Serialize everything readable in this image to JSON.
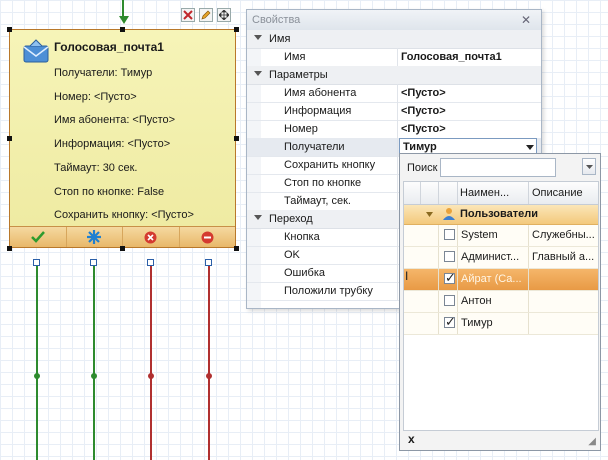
{
  "node": {
    "title": "Голосовая_почта1",
    "lines": [
      "Получатели: Тимур",
      "Номер: <Пусто>",
      "Имя абонента: <Пусто>",
      "Информация: <Пусто>",
      "Таймаут: 30 сек.",
      "Стоп по кнопке: False",
      "Сохранить кнопку: <Пусто>"
    ]
  },
  "properties": {
    "title": "Свойства",
    "close": "✕",
    "categories": {
      "name": "Имя",
      "params": "Параметры",
      "transition": "Переход"
    },
    "rows": {
      "name": {
        "label": "Имя",
        "value": "Голосовая_почта1"
      },
      "subscriber": {
        "label": "Имя абонента",
        "value": "<Пусто>"
      },
      "info": {
        "label": "Информация",
        "value": "<Пусто>"
      },
      "number": {
        "label": "Номер",
        "value": "<Пусто>"
      },
      "recipients": {
        "label": "Получатели",
        "value": "Тимур"
      },
      "save_button": {
        "label": "Сохранить кнопку",
        "value": ""
      },
      "stop_button": {
        "label": "Стоп по кнопке",
        "value": ""
      },
      "timeout": {
        "label": "Таймаут, сек.",
        "value": ""
      },
      "button": {
        "label": "Кнопка",
        "value": ""
      },
      "ok": {
        "label": "OK",
        "value": ""
      },
      "error": {
        "label": "Ошибка",
        "value": ""
      },
      "hangup": {
        "label": "Положили трубку",
        "value": ""
      }
    }
  },
  "popup": {
    "search_label": "Поиск",
    "search_value": "",
    "columns": [
      "Наимен...",
      "Описание"
    ],
    "group": "Пользователи",
    "rows": [
      {
        "name": "System",
        "desc": "Служебны...",
        "checked": false
      },
      {
        "name": "Админист...",
        "desc": "Главный а...",
        "checked": false
      },
      {
        "name": "Айрат (Са...",
        "desc": "",
        "checked": true
      },
      {
        "name": "Антон",
        "desc": "",
        "checked": false
      },
      {
        "name": "Тимур",
        "desc": "",
        "checked": true
      }
    ],
    "clear": "x"
  },
  "colors": {
    "node_fill": "#eeeaa0",
    "selection": "#e89a45",
    "wire_green": "#2e8b2e",
    "wire_red": "#b03030"
  }
}
